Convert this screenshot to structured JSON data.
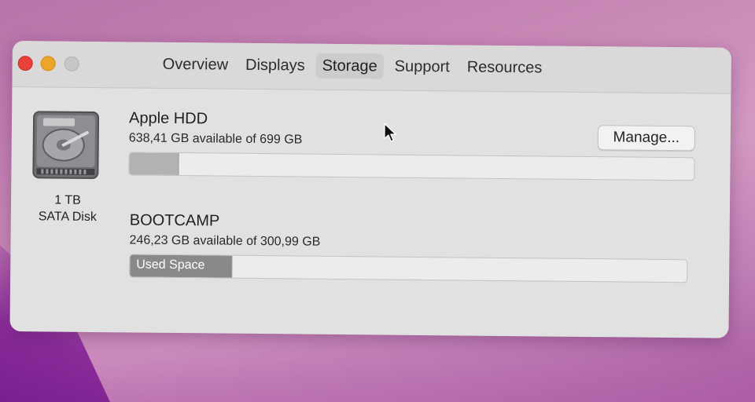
{
  "window": {
    "tabs": [
      {
        "label": "Overview"
      },
      {
        "label": "Displays"
      },
      {
        "label": "Storage"
      },
      {
        "label": "Support"
      },
      {
        "label": "Resources"
      }
    ],
    "active_tab": "Storage"
  },
  "disk": {
    "icon": "hard-disk-icon",
    "capacity": "1 TB",
    "type": "SATA Disk"
  },
  "volumes": [
    {
      "name": "Apple HDD",
      "detail": "638,41 GB available of 699 GB",
      "used_fraction": 0.087
    },
    {
      "name": "BOOTCAMP",
      "detail": "246,23 GB available of 300,99 GB",
      "used_fraction": 0.182,
      "bar_label": "Used Space"
    }
  ],
  "actions": {
    "manage_label": "Manage..."
  },
  "colors": {
    "close": "#e8413b",
    "minimize": "#eca62a",
    "zoom": "#c8c6c6",
    "wallpaper": "#c888b6"
  }
}
